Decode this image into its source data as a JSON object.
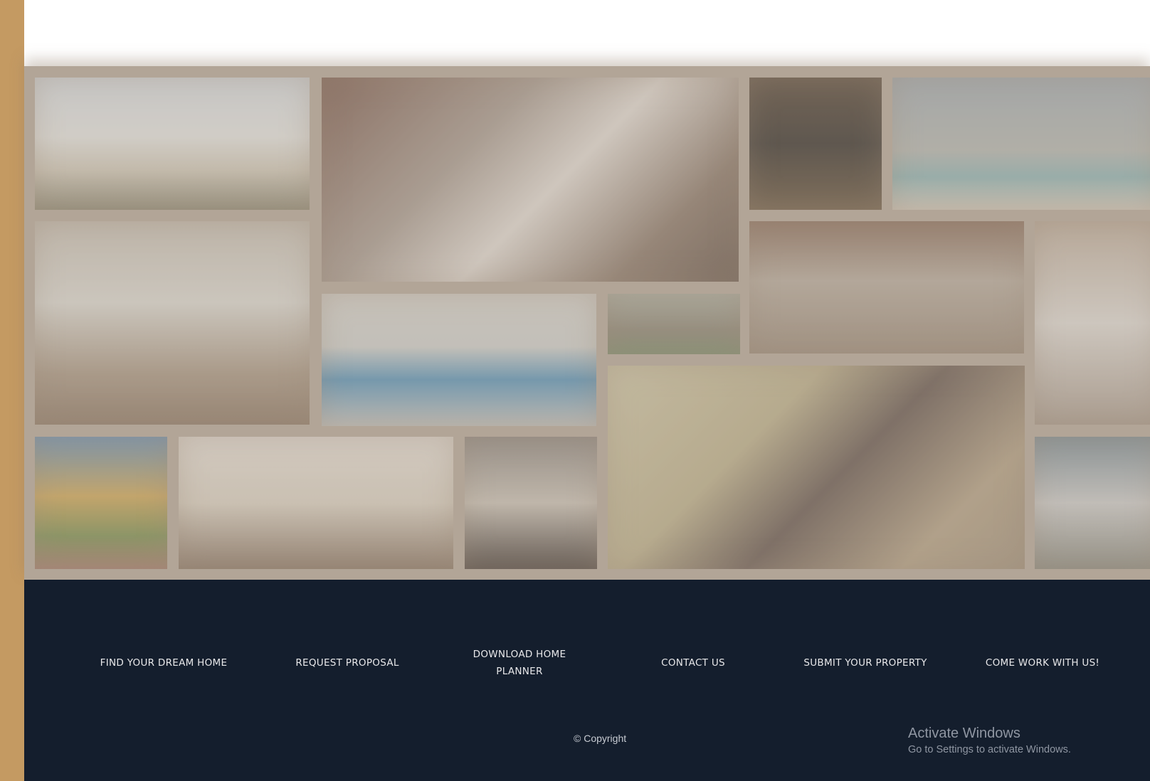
{
  "footer": {
    "nav": [
      {
        "label": "FIND YOUR DREAM HOME"
      },
      {
        "label": "REQUEST PROPOSAL"
      },
      {
        "label": "DOWNLOAD HOME PLANNER"
      },
      {
        "label": "CONTACT US"
      },
      {
        "label": "SUBMIT YOUR PROPERTY"
      },
      {
        "label": "COME WORK WITH US!"
      }
    ],
    "copyright": "© Copyright"
  },
  "watermark": {
    "title": "Activate Windows",
    "subtitle": "Go to Settings to activate Windows."
  },
  "colors": {
    "sidebar": "#c49a62",
    "footer_bg": "#141e2d",
    "gallery_bg": "#b2a597"
  }
}
